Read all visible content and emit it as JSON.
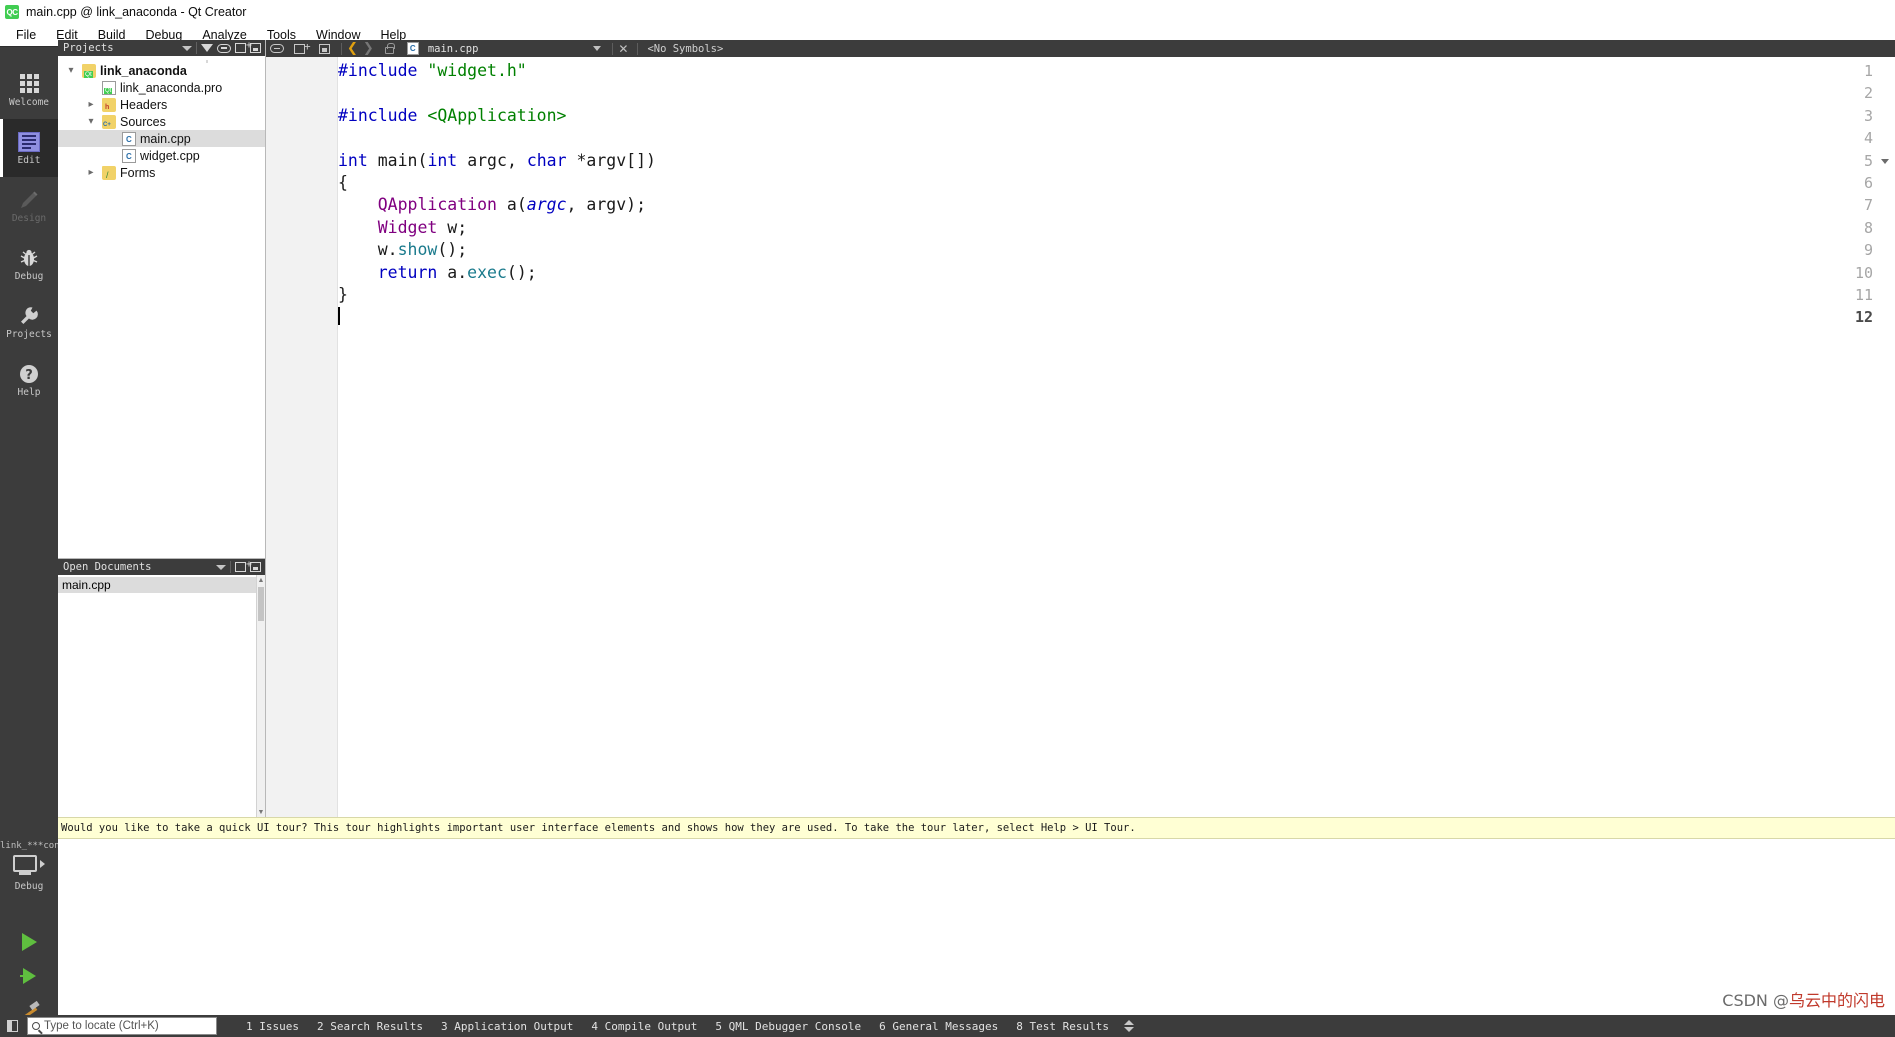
{
  "window": {
    "title": "main.cpp @ link_anaconda - Qt Creator",
    "logo_label": "QC"
  },
  "menubar": {
    "items": [
      {
        "label": "File"
      },
      {
        "label": "Edit"
      },
      {
        "label": "Build"
      },
      {
        "label": "Debug"
      },
      {
        "label": "Analyze"
      },
      {
        "label": "Tools"
      },
      {
        "label": "Window"
      },
      {
        "label": "Help"
      }
    ]
  },
  "modebar": {
    "items": [
      {
        "label": "Welcome",
        "icon": "grid-icon",
        "selected": false,
        "disabled": false
      },
      {
        "label": "Edit",
        "icon": "document-lines-icon",
        "selected": true,
        "disabled": false
      },
      {
        "label": "Design",
        "icon": "pencil-icon",
        "selected": false,
        "disabled": true
      },
      {
        "label": "Debug",
        "icon": "bug-icon",
        "selected": false,
        "disabled": false
      },
      {
        "label": "Projects",
        "icon": "wrench-icon",
        "selected": false,
        "disabled": false
      },
      {
        "label": "Help",
        "icon": "question-mark-icon",
        "selected": false,
        "disabled": false
      }
    ],
    "kit": {
      "project_name": "link_***conda",
      "build_config": "Debug"
    }
  },
  "projects_panel": {
    "title": "Projects",
    "tree": [
      {
        "label": "link_anaconda",
        "indent": 0,
        "twisty": "v",
        "icon": "qt-project-folder-icon",
        "bold": true,
        "selected": false
      },
      {
        "label": "link_anaconda.pro",
        "indent": 1,
        "twisty": "",
        "icon": "pro-file-icon",
        "bold": false,
        "selected": false
      },
      {
        "label": "Headers",
        "indent": 1,
        "twisty": ">",
        "icon": "headers-folder-icon",
        "bold": false,
        "selected": false
      },
      {
        "label": "Sources",
        "indent": 1,
        "twisty": "v",
        "icon": "sources-folder-icon",
        "bold": false,
        "selected": false
      },
      {
        "label": "main.cpp",
        "indent": 2,
        "twisty": "",
        "icon": "cpp-file-icon",
        "bold": false,
        "selected": true
      },
      {
        "label": "widget.cpp",
        "indent": 2,
        "twisty": "",
        "icon": "cpp-file-icon",
        "bold": false,
        "selected": false
      },
      {
        "label": "Forms",
        "indent": 1,
        "twisty": ">",
        "icon": "forms-folder-icon",
        "bold": false,
        "selected": false
      }
    ]
  },
  "open_documents": {
    "title": "Open Documents",
    "items": [
      {
        "label": "main.cpp",
        "selected": true
      }
    ]
  },
  "editor_toolbar": {
    "filename": "main.cpp",
    "symbols": "<No Symbols>"
  },
  "editor": {
    "current_line": 12,
    "lines": [
      {
        "n": 1,
        "fold": false,
        "tokens": [
          {
            "t": "#include ",
            "c": "k"
          },
          {
            "t": "\"widget.h\"",
            "c": "s"
          }
        ]
      },
      {
        "n": 2,
        "fold": false,
        "tokens": []
      },
      {
        "n": 3,
        "fold": false,
        "tokens": [
          {
            "t": "#include ",
            "c": "k"
          },
          {
            "t": "<QApplication>",
            "c": "s"
          }
        ]
      },
      {
        "n": 4,
        "fold": false,
        "tokens": []
      },
      {
        "n": 5,
        "fold": true,
        "tokens": [
          {
            "t": "int ",
            "c": "k"
          },
          {
            "t": "main",
            "c": "d"
          },
          {
            "t": "(",
            "c": "d"
          },
          {
            "t": "int ",
            "c": "k"
          },
          {
            "t": "argc",
            "c": "d"
          },
          {
            "t": ", ",
            "c": "d"
          },
          {
            "t": "char ",
            "c": "k"
          },
          {
            "t": "*argv[])",
            "c": "d"
          }
        ]
      },
      {
        "n": 6,
        "fold": false,
        "tokens": [
          {
            "t": "{",
            "c": "d"
          }
        ]
      },
      {
        "n": 7,
        "fold": false,
        "tokens": [
          {
            "t": "    ",
            "c": "d"
          },
          {
            "t": "QApplication",
            "c": "t"
          },
          {
            "t": " a(",
            "c": "d"
          },
          {
            "t": "argc",
            "c": "p"
          },
          {
            "t": ", ",
            "c": "d"
          },
          {
            "t": "argv",
            "c": "d"
          },
          {
            "t": ");",
            "c": "d"
          }
        ]
      },
      {
        "n": 8,
        "fold": false,
        "tokens": [
          {
            "t": "    ",
            "c": "d"
          },
          {
            "t": "Widget",
            "c": "t"
          },
          {
            "t": " w;",
            "c": "d"
          }
        ]
      },
      {
        "n": 9,
        "fold": false,
        "tokens": [
          {
            "t": "    w.",
            "c": "d"
          },
          {
            "t": "show",
            "c": "f"
          },
          {
            "t": "();",
            "c": "d"
          }
        ]
      },
      {
        "n": 10,
        "fold": false,
        "tokens": [
          {
            "t": "    ",
            "c": "d"
          },
          {
            "t": "return ",
            "c": "k"
          },
          {
            "t": "a.",
            "c": "d"
          },
          {
            "t": "exec",
            "c": "f"
          },
          {
            "t": "();",
            "c": "d"
          }
        ]
      },
      {
        "n": 11,
        "fold": false,
        "tokens": [
          {
            "t": "}",
            "c": "d"
          }
        ]
      },
      {
        "n": 12,
        "fold": false,
        "tokens": []
      }
    ]
  },
  "tour_bar": {
    "message": "Would you like to take a quick UI tour? This tour highlights important user interface elements and shows how they are used. To take the tour later, select Help > UI Tour."
  },
  "statusbar": {
    "locator_placeholder": "Type to locate (Ctrl+K)",
    "panes": [
      {
        "label": "1 Issues"
      },
      {
        "label": "2 Search Results"
      },
      {
        "label": "3 Application Output"
      },
      {
        "label": "4 Compile Output"
      },
      {
        "label": "5 QML Debugger Console"
      },
      {
        "label": "6 General Messages"
      },
      {
        "label": "8 Test Results"
      }
    ]
  },
  "watermark": {
    "prefix": "CSDN @",
    "name": "乌云中的闪电"
  },
  "colors": {
    "dark_chrome": "#3c3c3c",
    "accent_green": "#41cd52",
    "tour_yellow": "#ffffd4",
    "selection_gray": "#dcdcdc"
  }
}
